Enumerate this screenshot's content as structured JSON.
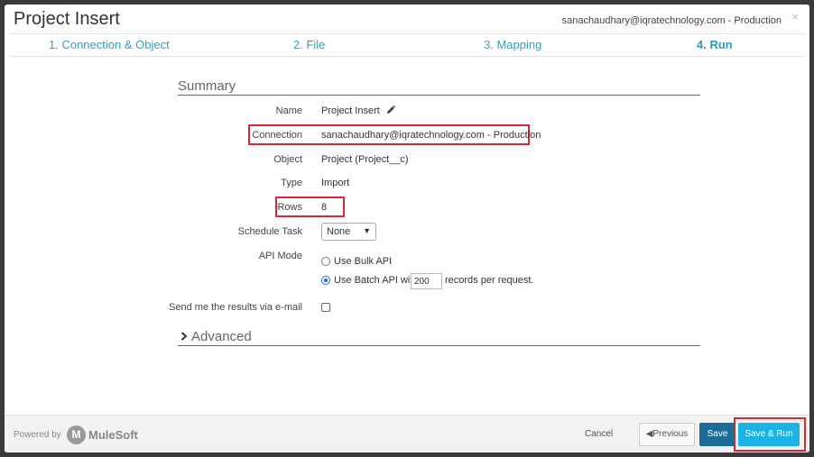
{
  "header": {
    "title": "Project Insert",
    "account": "sanachaudhary@iqratechnology.com - Production",
    "close_glyph": "×"
  },
  "steps": [
    {
      "label": "1. Connection & Object"
    },
    {
      "label": "2. File"
    },
    {
      "label": "3. Mapping"
    },
    {
      "label": "4. Run"
    }
  ],
  "summary": {
    "heading": "Summary",
    "name_label": "Name",
    "name_value": "Project Insert",
    "connection_label": "Connection",
    "connection_value": "sanachaudhary@iqratechnology.com - Production",
    "object_label": "Object",
    "object_value": "Project (Project__c)",
    "type_label": "Type",
    "type_value": "Import",
    "rows_label": "Rows",
    "rows_value": "8",
    "schedule_label": "Schedule Task",
    "schedule_value": "None",
    "api_mode_label": "API Mode",
    "bulk_label": "Use Bulk API",
    "batch_label": "Use Batch API with",
    "batch_size": "200",
    "batch_suffix": "records per request.",
    "email_label": "Send me the results via e-mail"
  },
  "advanced": {
    "heading": "Advanced"
  },
  "footer": {
    "powered_by": "Powered by",
    "brand": "MuleSoft",
    "brand_mark": "M",
    "cancel": "Cancel",
    "previous": "Previous",
    "save": "Save",
    "save_run": "Save & Run"
  },
  "icons": {
    "edit": "pencil-icon",
    "advanced_toggle": "chevron-right-icon",
    "previous": "caret-left-icon"
  },
  "colors": {
    "accent": "#1fa0cc",
    "highlight": "#d9282f",
    "save": "#1b6c99",
    "save_run": "#1cb3e6"
  }
}
